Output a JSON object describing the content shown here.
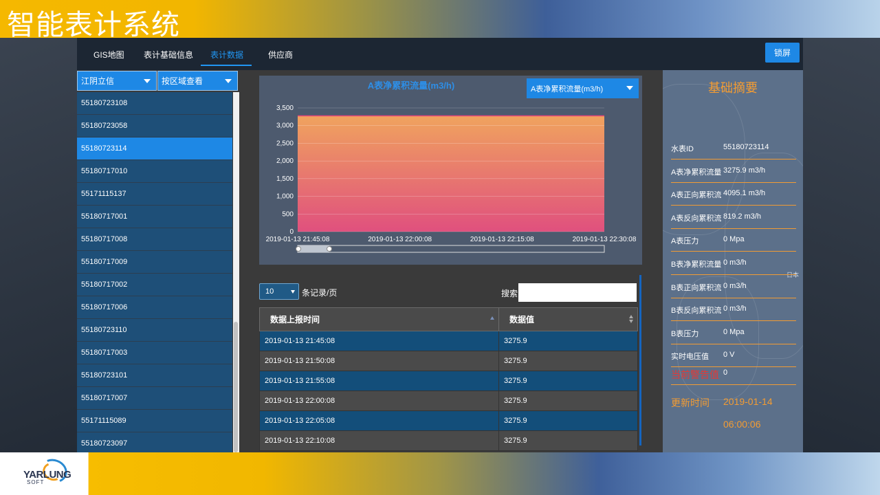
{
  "page_title": "智能表计系统",
  "logo": {
    "name": "YARLUNG",
    "sub": "SOFT"
  },
  "nav": {
    "tabs": [
      {
        "label": "GIS地图",
        "active": false
      },
      {
        "label": "表计基础信息",
        "active": false
      },
      {
        "label": "表计数据",
        "active": true
      },
      {
        "label": "供应商",
        "active": false
      }
    ],
    "lock_label": "锁屏"
  },
  "sidebar": {
    "company_select": "江阴立信",
    "view_select": "按区域查看",
    "meters": [
      "55180723108",
      "55180723058",
      "55180723114",
      "55180717010",
      "55171115137",
      "55180717001",
      "55180717008",
      "55180717009",
      "55180717002",
      "55180717006",
      "55180723110",
      "55180717003",
      "55180723101",
      "55180717007",
      "55171115089",
      "55180723097"
    ],
    "selected_index": 2
  },
  "chart_data": {
    "type": "area",
    "title": "A表净累积流量(m3/h)",
    "metric_select": "A表净累积流量(m3/h)",
    "x": [
      "2019-01-13 21:45:08",
      "2019-01-13 21:50:08",
      "2019-01-13 21:55:08",
      "2019-01-13 22:00:08",
      "2019-01-13 22:05:08",
      "2019-01-13 22:10:08",
      "2019-01-13 22:15:08",
      "2019-01-13 22:20:08",
      "2019-01-13 22:25:08",
      "2019-01-13 22:30:08"
    ],
    "x_tick_labels": [
      "2019-01-13 21:45:08",
      "2019-01-13 22:00:08",
      "2019-01-13 22:15:08",
      "2019-01-13 22:30:08"
    ],
    "values": [
      3275.9,
      3275.9,
      3275.9,
      3275.9,
      3275.9,
      3275.9,
      3275.9,
      3275.9,
      3275.9,
      3275.9
    ],
    "ylim": [
      0,
      3500
    ],
    "y_ticks": [
      "0",
      "500",
      "1,000",
      "1,500",
      "2,000",
      "2,500",
      "3,000",
      "3,500"
    ],
    "grid": true,
    "colors": {
      "top": "#f0a35e",
      "bottom": "#e0507e",
      "line": "#e8457a"
    }
  },
  "table": {
    "page_size": "10",
    "per_page_label": "条记录/页",
    "search_label": "搜索:",
    "columns": [
      "数据上报时间",
      "数据值"
    ],
    "rows": [
      [
        "2019-01-13 21:45:08",
        "3275.9"
      ],
      [
        "2019-01-13 21:50:08",
        "3275.9"
      ],
      [
        "2019-01-13 21:55:08",
        "3275.9"
      ],
      [
        "2019-01-13 22:00:08",
        "3275.9"
      ],
      [
        "2019-01-13 22:05:08",
        "3275.9"
      ],
      [
        "2019-01-13 22:10:08",
        "3275.9"
      ]
    ]
  },
  "summary": {
    "title": "基础摘要",
    "rows": [
      {
        "key": "水表ID",
        "value": "55180723114"
      },
      {
        "key": "A表净累积流量",
        "value": "3275.9 m3/h"
      },
      {
        "key": "A表正向累积流",
        "value": "4095.1 m3/h"
      },
      {
        "key": "A表反向累积流",
        "value": "819.2 m3/h"
      },
      {
        "key": "A表压力",
        "value": "0 Mpa"
      },
      {
        "key": "B表净累积流量",
        "value": "0 m3/h"
      },
      {
        "key": "B表正向累积流",
        "value": "0 m3/h"
      },
      {
        "key": "B表反向累积流",
        "value": "0 m3/h"
      },
      {
        "key": "B表压力",
        "value": "0 Mpa"
      },
      {
        "key": "实时电压值",
        "value": "0 V"
      }
    ],
    "warning": {
      "key": "当前警告值",
      "value": "0"
    },
    "update": {
      "key": "更新时间",
      "date": "2019-01-14",
      "time": "06:00:06"
    },
    "map_label": "日本"
  }
}
